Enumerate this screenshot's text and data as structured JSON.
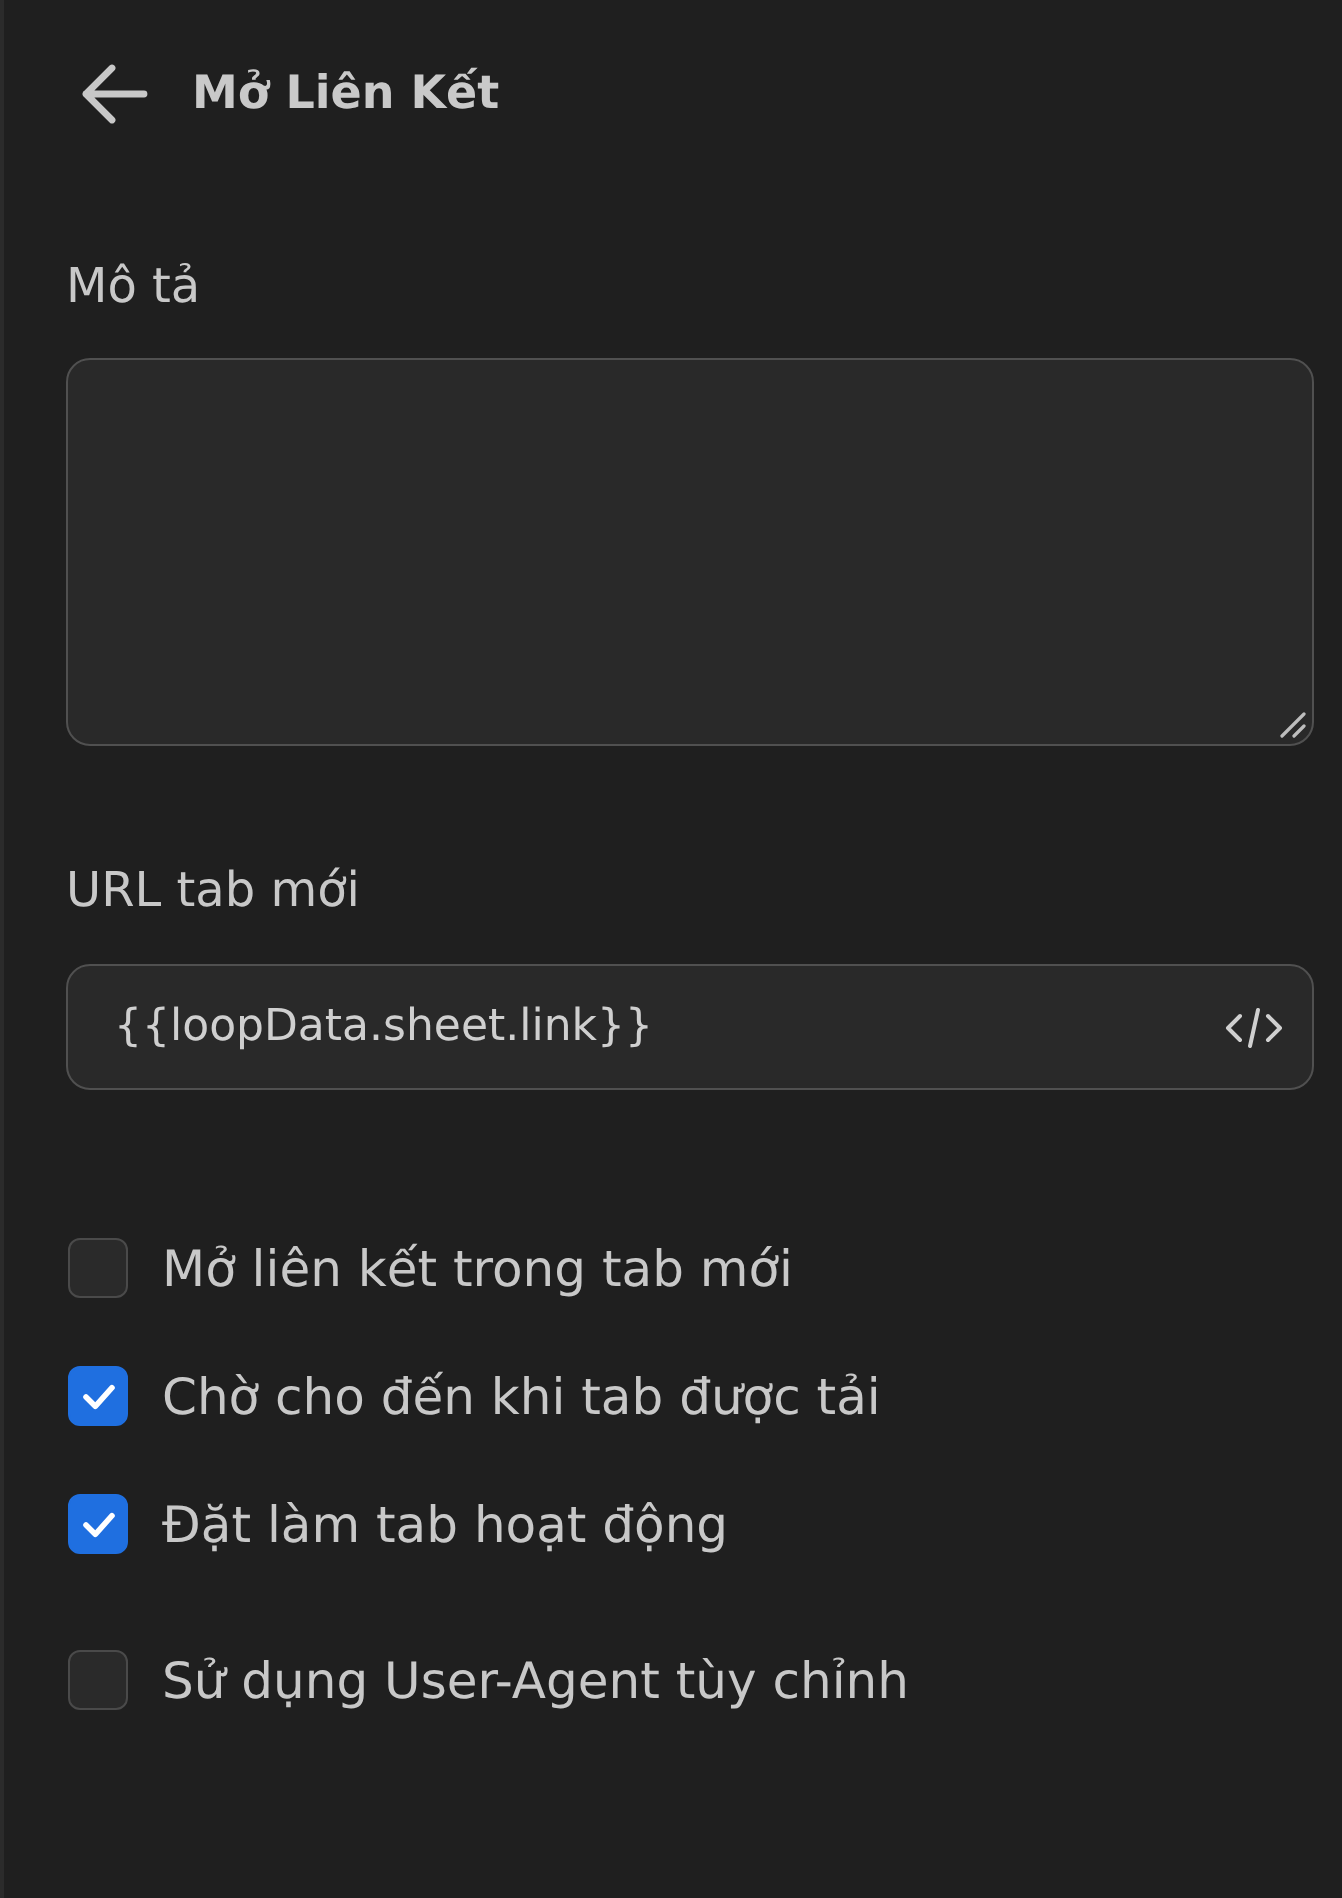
{
  "header": {
    "title": "Mở Liên Kết"
  },
  "description": {
    "label": "Mô tả"
  },
  "url_field": {
    "label": "URL tab mới",
    "value": "{{loopData.sheet.link}}"
  },
  "tab_options": [
    {
      "label": "Mở liên kết trong tab mới",
      "checked": false
    },
    {
      "label": "Chờ cho đến khi tab được tải",
      "checked": true
    },
    {
      "label": "Đặt làm tab hoạt động",
      "checked": true
    }
  ],
  "user_agent_option": {
    "label": "Sử dụng User-Agent tùy chỉnh",
    "checked": false
  }
}
